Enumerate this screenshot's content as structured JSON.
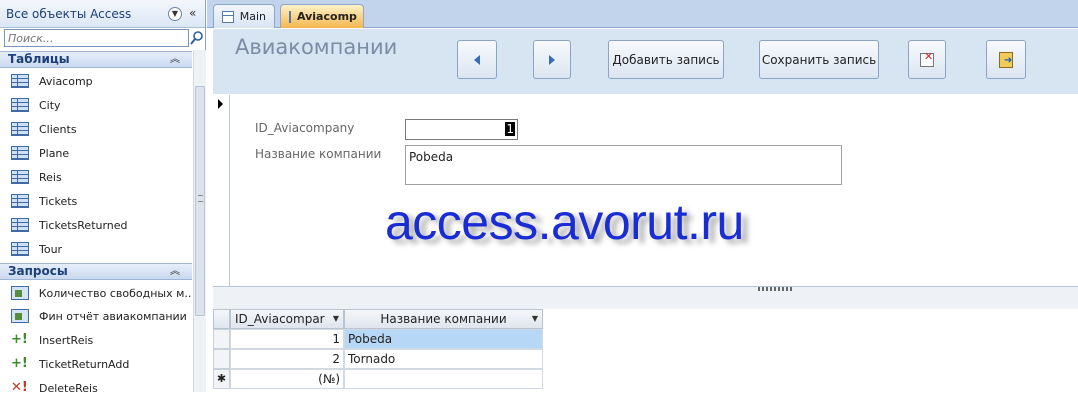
{
  "nav": {
    "title": "Все объекты Access",
    "search_placeholder": "Поиск...",
    "groups": [
      {
        "label": "Таблицы",
        "items": [
          "Aviacomp",
          "City",
          "Clients",
          "Plane",
          "Reis",
          "Tickets",
          "TicketsReturned",
          "Tour"
        ]
      },
      {
        "label": "Запросы",
        "items": [
          "Количество свободных м...",
          "Фин отчёт авиакомпании",
          "InsertReis",
          "TicketReturnAdd",
          "DeleteReis"
        ]
      }
    ]
  },
  "tabs": [
    {
      "label": "Main"
    },
    {
      "label": "Aviacomp"
    }
  ],
  "form": {
    "title": "Авиакомпании",
    "buttons": {
      "add": "Добавить запись",
      "save": "Сохранить запись"
    },
    "fields": {
      "id_label": "ID_Aviacompany",
      "id_value": "1",
      "name_label": "Название компании",
      "name_value": "Pobeda"
    }
  },
  "watermark": "access.avorut.ru",
  "datasheet": {
    "columns": [
      "ID_Aviacompar",
      "Название компании"
    ],
    "rows": [
      {
        "id": "1",
        "name": "Pobeda"
      },
      {
        "id": "2",
        "name": "Tornado"
      }
    ],
    "new_row_marker": "✱",
    "new_row_id": "(№)"
  },
  "colors": {
    "accent_tab": "#f4b64e",
    "header_bg": "#d7e4f2",
    "watermark": "#1a2cd4",
    "selected_cell": "#b7d7f6"
  }
}
